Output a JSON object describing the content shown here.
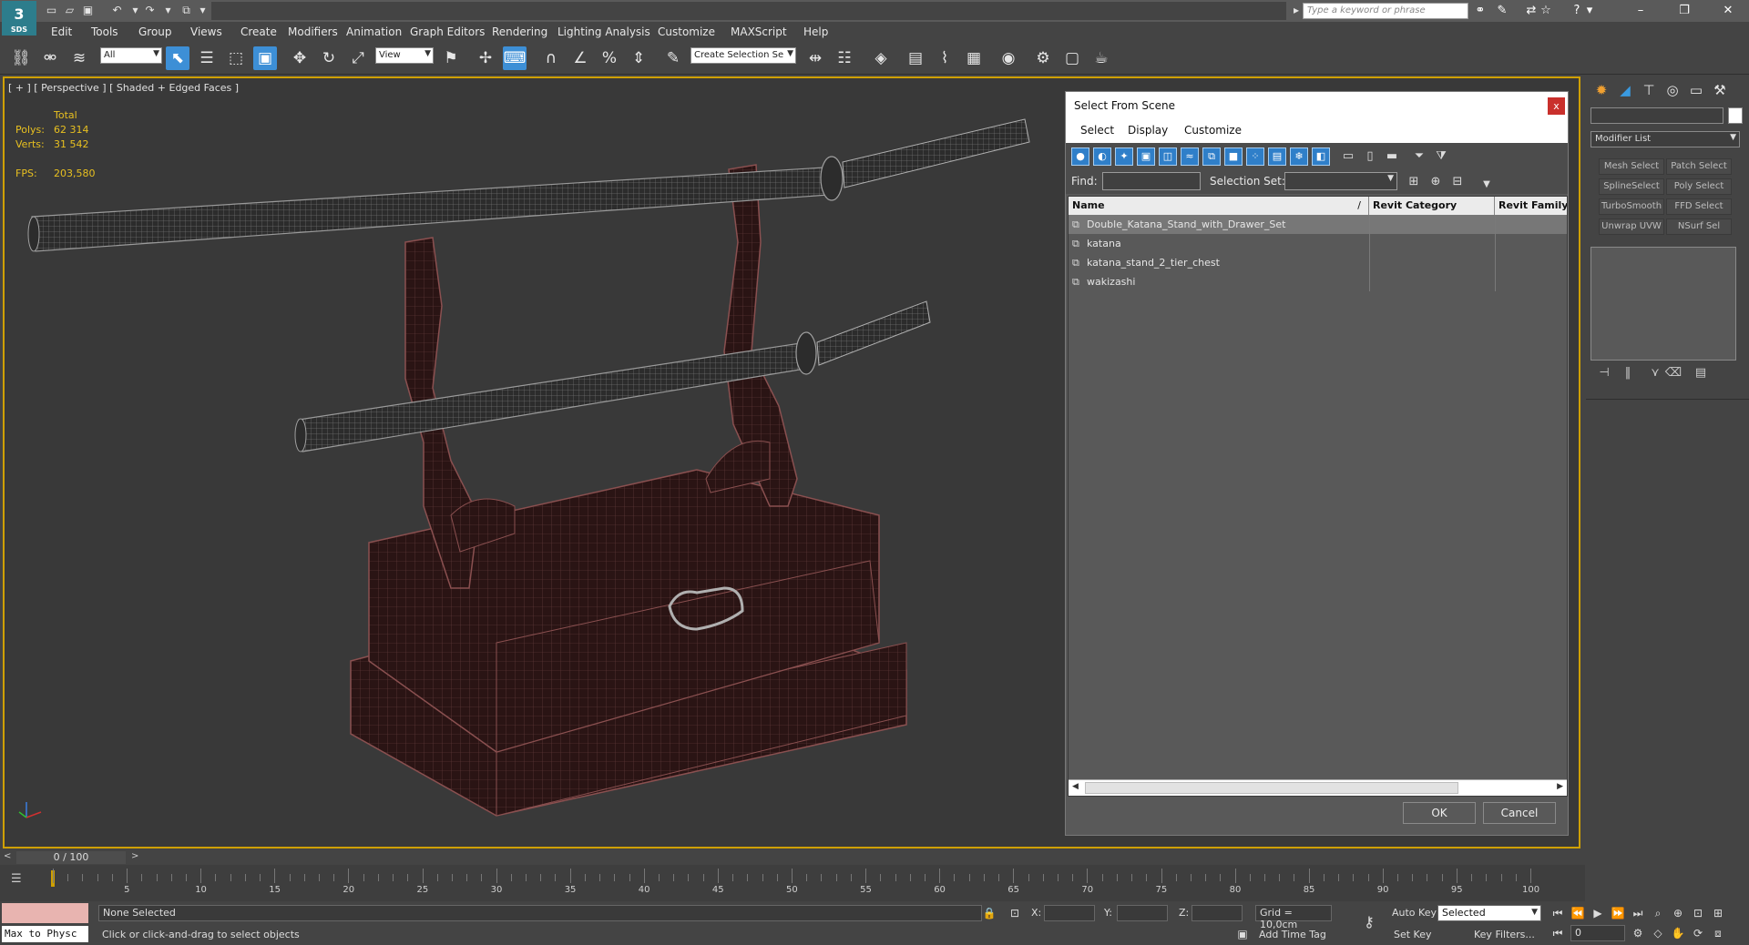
{
  "app": {
    "logo_text": "3",
    "logo_version": "SDS",
    "search_placeholder": "Type a keyword or phrase"
  },
  "menu": [
    "Edit",
    "Tools",
    "Group",
    "Views",
    "Create",
    "Modifiers",
    "Animation",
    "Graph Editors",
    "Rendering",
    "Lighting Analysis",
    "Customize",
    "MAXScript",
    "Help"
  ],
  "toolbar": {
    "filter_dropdown": "All",
    "ref_coord_dropdown": "View",
    "selection_set_dropdown": "Create Selection Se"
  },
  "viewport": {
    "label": "[ + ] [ Perspective ] [ Shaded + Edged Faces ]",
    "stats": {
      "header": "Total",
      "polys_label": "Polys:",
      "polys_value": "62 314",
      "verts_label": "Verts:",
      "verts_value": "31 542",
      "fps_label": "FPS:",
      "fps_value": "203,580"
    }
  },
  "dialog": {
    "title": "Select From Scene",
    "close": "x",
    "menu": [
      "Select",
      "Display",
      "Customize"
    ],
    "find_label": "Find:",
    "find_value": "",
    "selection_set_label": "Selection Set:",
    "selection_set_value": "",
    "columns": [
      "Name",
      "Revit Category",
      "Revit Family"
    ],
    "sort_indicator": "/",
    "rows": [
      {
        "name": "Double_Katana_Stand_with_Drawer_Set",
        "selected": true
      },
      {
        "name": "katana",
        "selected": false
      },
      {
        "name": "katana_stand_2_tier_chest",
        "selected": false
      },
      {
        "name": "wakizashi",
        "selected": false
      }
    ],
    "ok": "OK",
    "cancel": "Cancel"
  },
  "command_panel": {
    "modifier_list": "Modifier List",
    "modifier_buttons": [
      "Mesh Select",
      "Patch Select",
      "SplineSelect",
      "Poly Select",
      "TurboSmooth",
      "FFD Select",
      "Unwrap UVW",
      "NSurf Sel"
    ]
  },
  "timeline": {
    "frame_display": "0 / 100",
    "ticks": [
      "5",
      "10",
      "15",
      "20",
      "25",
      "30",
      "35",
      "40",
      "45",
      "50",
      "55",
      "60",
      "65",
      "70",
      "75",
      "80",
      "85",
      "90",
      "95",
      "100"
    ]
  },
  "status": {
    "maxscript_label": "Max to Physc",
    "selection_status": "None Selected",
    "prompt": "Click or click-and-drag to select objects",
    "x_label": "X:",
    "y_label": "Y:",
    "z_label": "Z:",
    "grid": "Grid = 10,0cm",
    "add_time_tag": "Add Time Tag",
    "auto_key": "Auto Key",
    "set_key": "Set Key",
    "key_mode_dropdown": "Selected",
    "key_filters": "Key Filters...",
    "current_frame": "0"
  }
}
